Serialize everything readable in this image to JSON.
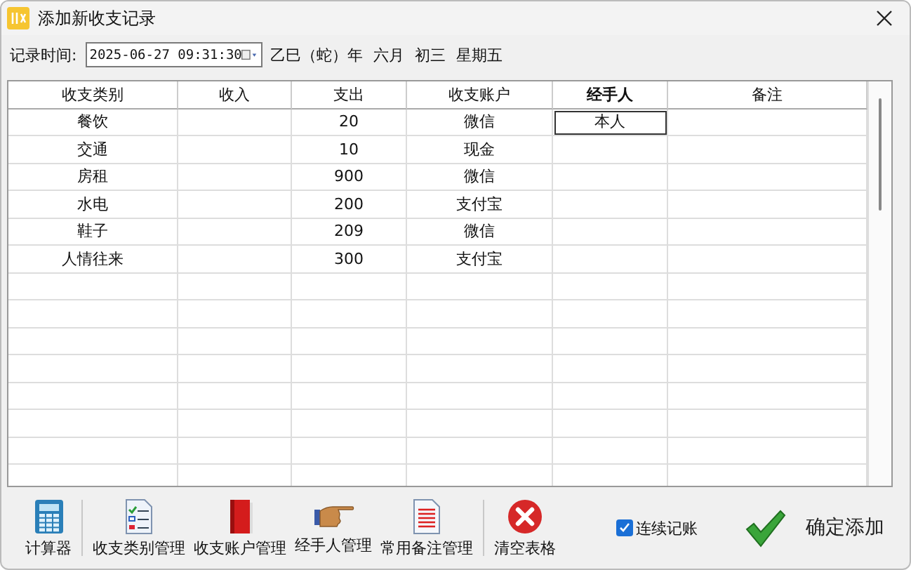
{
  "window": {
    "title": "添加新收支记录"
  },
  "record_time": {
    "label": "记录时间:",
    "value": "2025-06-27 09:31:30",
    "lunar_date": "乙巳（蛇）年 六月 初三 星期五"
  },
  "table": {
    "columns": [
      {
        "label": "收支类别",
        "selected": false
      },
      {
        "label": "收入",
        "selected": false
      },
      {
        "label": "支出",
        "selected": false
      },
      {
        "label": "收支账户",
        "selected": false
      },
      {
        "label": "经手人",
        "selected": true
      },
      {
        "label": "备注",
        "selected": false
      }
    ],
    "rows": [
      {
        "category": "餐饮",
        "expense": "20",
        "account": "微信",
        "handler": "本人",
        "focused": true
      },
      {
        "category": "交通",
        "expense": "10",
        "account": "现金",
        "focused": false
      },
      {
        "category": "房租",
        "expense": "900",
        "account": "微信",
        "focused": false
      },
      {
        "category": "水电",
        "expense": "200",
        "account": "支付宝",
        "focused": false
      },
      {
        "category": "鞋子",
        "expense": "209",
        "account": "微信",
        "focused": false
      },
      {
        "category": "人情往来",
        "expense": "300",
        "account": "支付宝",
        "focused": false
      }
    ]
  },
  "toolbar": [
    {
      "kind": "calculator",
      "label": "计算器",
      "separator_after": true
    },
    {
      "kind": "checklist",
      "label": "收支类别管理",
      "separator_after": false
    },
    {
      "kind": "book",
      "label": "收支账户管理",
      "separator_after": false
    },
    {
      "kind": "hand",
      "label": "经手人管理",
      "separator_after": false
    },
    {
      "kind": "notes",
      "label": "常用备注管理",
      "separator_after": true
    },
    {
      "kind": "clear",
      "label": "清空表格",
      "separator_after": false
    }
  ],
  "continuous": {
    "label": "连续记账",
    "checked": true
  },
  "confirm": {
    "label": "确定添加"
  }
}
